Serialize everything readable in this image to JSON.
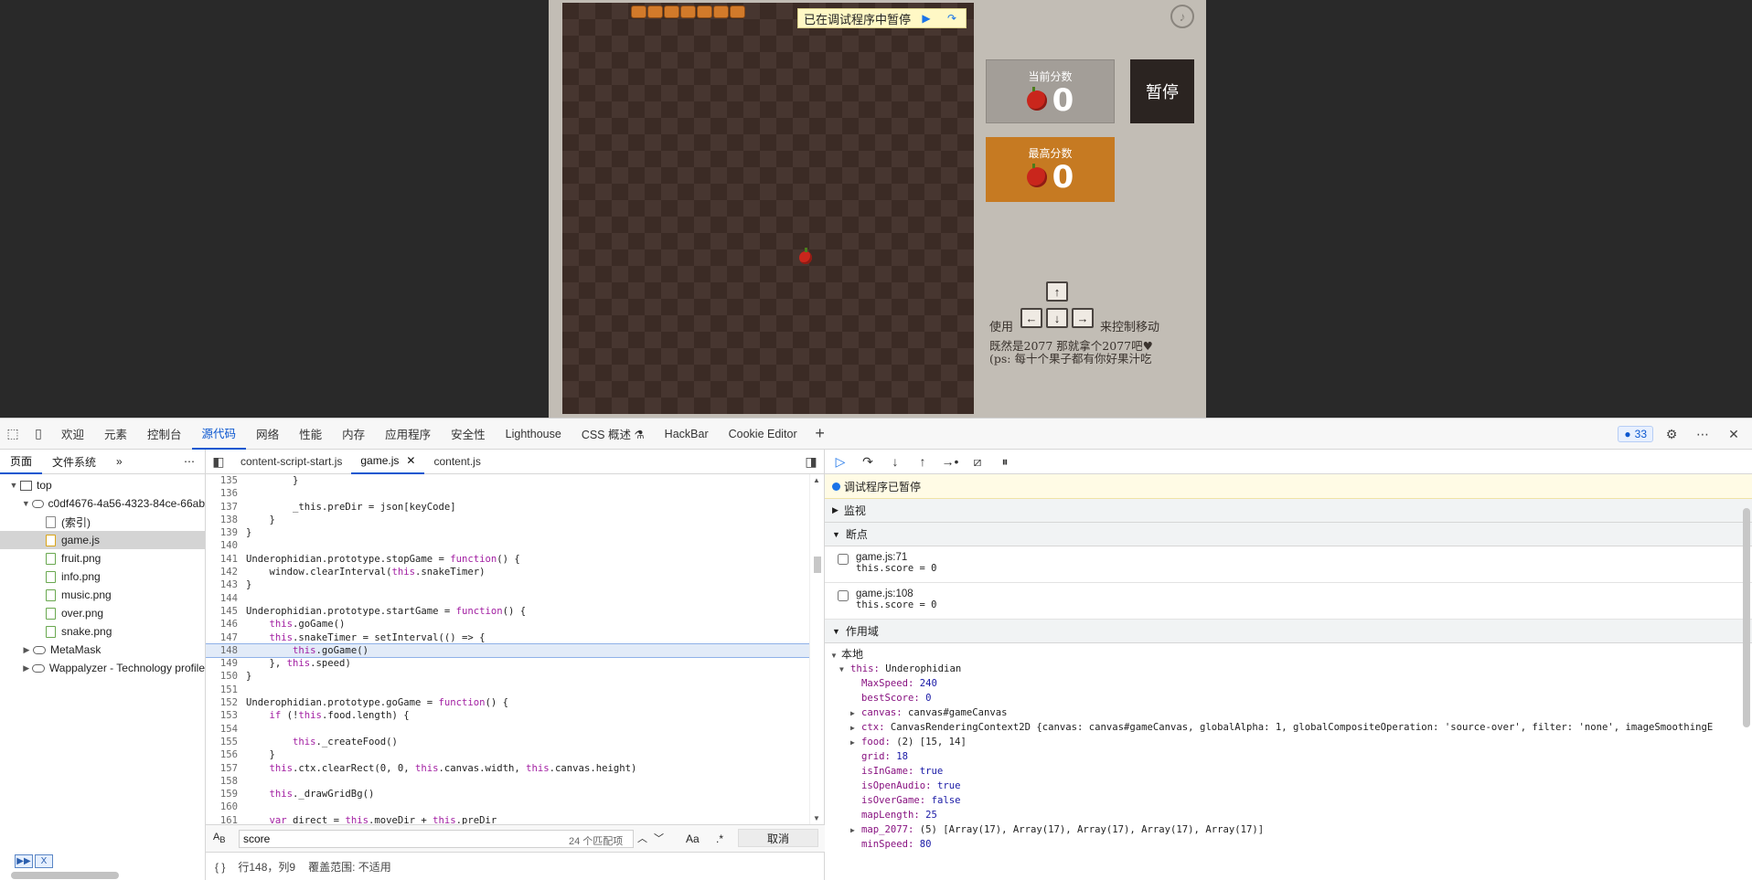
{
  "game": {
    "debug_banner_text": "已在调试程序中暂停",
    "current_score_label": "当前分数",
    "current_score_value": "0",
    "best_score_label": "最高分数",
    "best_score_value": "0",
    "pause_label": "暂停",
    "help_use": "使用",
    "help_move": "来控制移动",
    "help_line2": "既然是2077 那就拿个2077吧♥",
    "help_line3": "(ps: 每十个果子都有你好果汁吃",
    "keys": {
      "up": "↑",
      "left": "←",
      "down": "↓",
      "right": "→"
    }
  },
  "devtools": {
    "tabs": [
      "欢迎",
      "元素",
      "控制台",
      "源代码",
      "网络",
      "性能",
      "内存",
      "应用程序",
      "安全性",
      "Lighthouse",
      "CSS 概述 ⚗",
      "HackBar",
      "Cookie Editor"
    ],
    "active_tab": "源代码",
    "issues_count": "33",
    "navigator": {
      "tabs": [
        "页面",
        "文件系统"
      ],
      "tree": [
        {
          "label": "top",
          "indent": 0,
          "icon": "frame",
          "toggle": "▼"
        },
        {
          "label": "c0df4676-4a56-4323-84ce-66ab",
          "indent": 1,
          "icon": "cloud",
          "toggle": "▼"
        },
        {
          "label": "(索引)",
          "indent": 2,
          "icon": "idx",
          "toggle": ""
        },
        {
          "label": "game.js",
          "indent": 2,
          "icon": "js",
          "toggle": "",
          "selected": true
        },
        {
          "label": "fruit.png",
          "indent": 2,
          "icon": "file",
          "toggle": ""
        },
        {
          "label": "info.png",
          "indent": 2,
          "icon": "file",
          "toggle": ""
        },
        {
          "label": "music.png",
          "indent": 2,
          "icon": "file",
          "toggle": ""
        },
        {
          "label": "over.png",
          "indent": 2,
          "icon": "file",
          "toggle": ""
        },
        {
          "label": "snake.png",
          "indent": 2,
          "icon": "file",
          "toggle": ""
        },
        {
          "label": "MetaMask",
          "indent": 1,
          "icon": "cloud",
          "toggle": "▶"
        },
        {
          "label": "Wappalyzer - Technology profile",
          "indent": 1,
          "icon": "cloud",
          "toggle": "▶"
        }
      ]
    },
    "file_tabs": [
      "content-script-start.js",
      "game.js",
      "content.js"
    ],
    "active_file": "game.js",
    "code_lines": [
      {
        "n": "135",
        "t": "        }"
      },
      {
        "n": "136",
        "t": ""
      },
      {
        "n": "137",
        "t": "        _this.preDir = json[keyCode]"
      },
      {
        "n": "138",
        "t": "    }"
      },
      {
        "n": "139",
        "t": "}"
      },
      {
        "n": "140",
        "t": ""
      },
      {
        "n": "141",
        "t": "Underophidian.prototype.stopGame = function() {"
      },
      {
        "n": "142",
        "t": "    window.clearInterval(this.snakeTimer)"
      },
      {
        "n": "143",
        "t": "}"
      },
      {
        "n": "144",
        "t": ""
      },
      {
        "n": "145",
        "t": "Underophidian.prototype.startGame = function() {"
      },
      {
        "n": "146",
        "t": "    this.goGame()"
      },
      {
        "n": "147",
        "t": "    this.snakeTimer = setInterval(() => {"
      },
      {
        "n": "148",
        "t": "        this.goGame()",
        "hl": true
      },
      {
        "n": "149",
        "t": "    }, this.speed)"
      },
      {
        "n": "150",
        "t": "}"
      },
      {
        "n": "151",
        "t": ""
      },
      {
        "n": "152",
        "t": "Underophidian.prototype.goGame = function() {"
      },
      {
        "n": "153",
        "t": "    if (!this.food.length) {"
      },
      {
        "n": "154",
        "t": ""
      },
      {
        "n": "155",
        "t": "        this._createFood()"
      },
      {
        "n": "156",
        "t": "    }"
      },
      {
        "n": "157",
        "t": "    this.ctx.clearRect(0, 0, this.canvas.width, this.canvas.height)"
      },
      {
        "n": "158",
        "t": ""
      },
      {
        "n": "159",
        "t": "    this._drawGridBg()"
      },
      {
        "n": "160",
        "t": ""
      },
      {
        "n": "161",
        "t": "    var direct = this.moveDir + this.preDir"
      }
    ],
    "search": {
      "value": "score",
      "matches": "24 个匹配项",
      "aa": "Aa",
      "regex": ".*",
      "cancel": "取消"
    },
    "status": {
      "braces": "{ }",
      "position": "行148，列9",
      "coverage": "覆盖范围: 不适用"
    },
    "debugger": {
      "paused_text": "调试程序已暂停",
      "watch_label": "监视",
      "breakpoints_label": "断点",
      "breakpoints": [
        {
          "name": "game.js:71",
          "cond": "this.score = 0"
        },
        {
          "name": "game.js:108",
          "cond": "this.score = 0"
        }
      ],
      "scope_label": "作用域",
      "local_label": "本地",
      "this_label": "this:",
      "this_value": "Underophidian",
      "scope_rows": [
        {
          "k": "MaxSpeed:",
          "v": "240",
          "t": "num",
          "tri": ""
        },
        {
          "k": "bestScore:",
          "v": "0",
          "t": "num",
          "tri": ""
        },
        {
          "k": "canvas:",
          "v": "canvas#gameCanvas",
          "t": "v",
          "tri": "▶"
        },
        {
          "k": "ctx:",
          "v": "CanvasRenderingContext2D {canvas: canvas#gameCanvas, globalAlpha: 1, globalCompositeOperation: 'source-over', filter: 'none', imageSmoothingE",
          "t": "v",
          "tri": "▶"
        },
        {
          "k": "food:",
          "v": "(2) [15, 14]",
          "t": "v",
          "tri": "▶"
        },
        {
          "k": "grid:",
          "v": "18",
          "t": "num",
          "tri": ""
        },
        {
          "k": "isInGame:",
          "v": "true",
          "t": "num",
          "tri": ""
        },
        {
          "k": "isOpenAudio:",
          "v": "true",
          "t": "num",
          "tri": ""
        },
        {
          "k": "isOverGame:",
          "v": "false",
          "t": "num",
          "tri": ""
        },
        {
          "k": "mapLength:",
          "v": "25",
          "t": "num",
          "tri": ""
        },
        {
          "k": "map_2077:",
          "v": "(5) [Array(17), Array(17), Array(17), Array(17), Array(17)]",
          "t": "v",
          "tri": "▶"
        },
        {
          "k": "minSpeed:",
          "v": "80",
          "t": "num",
          "tri": ""
        }
      ]
    }
  },
  "colors": {
    "accent": "#0b57d0",
    "best_score_bg": "#c67a22",
    "pause_bg": "#2b2421"
  }
}
